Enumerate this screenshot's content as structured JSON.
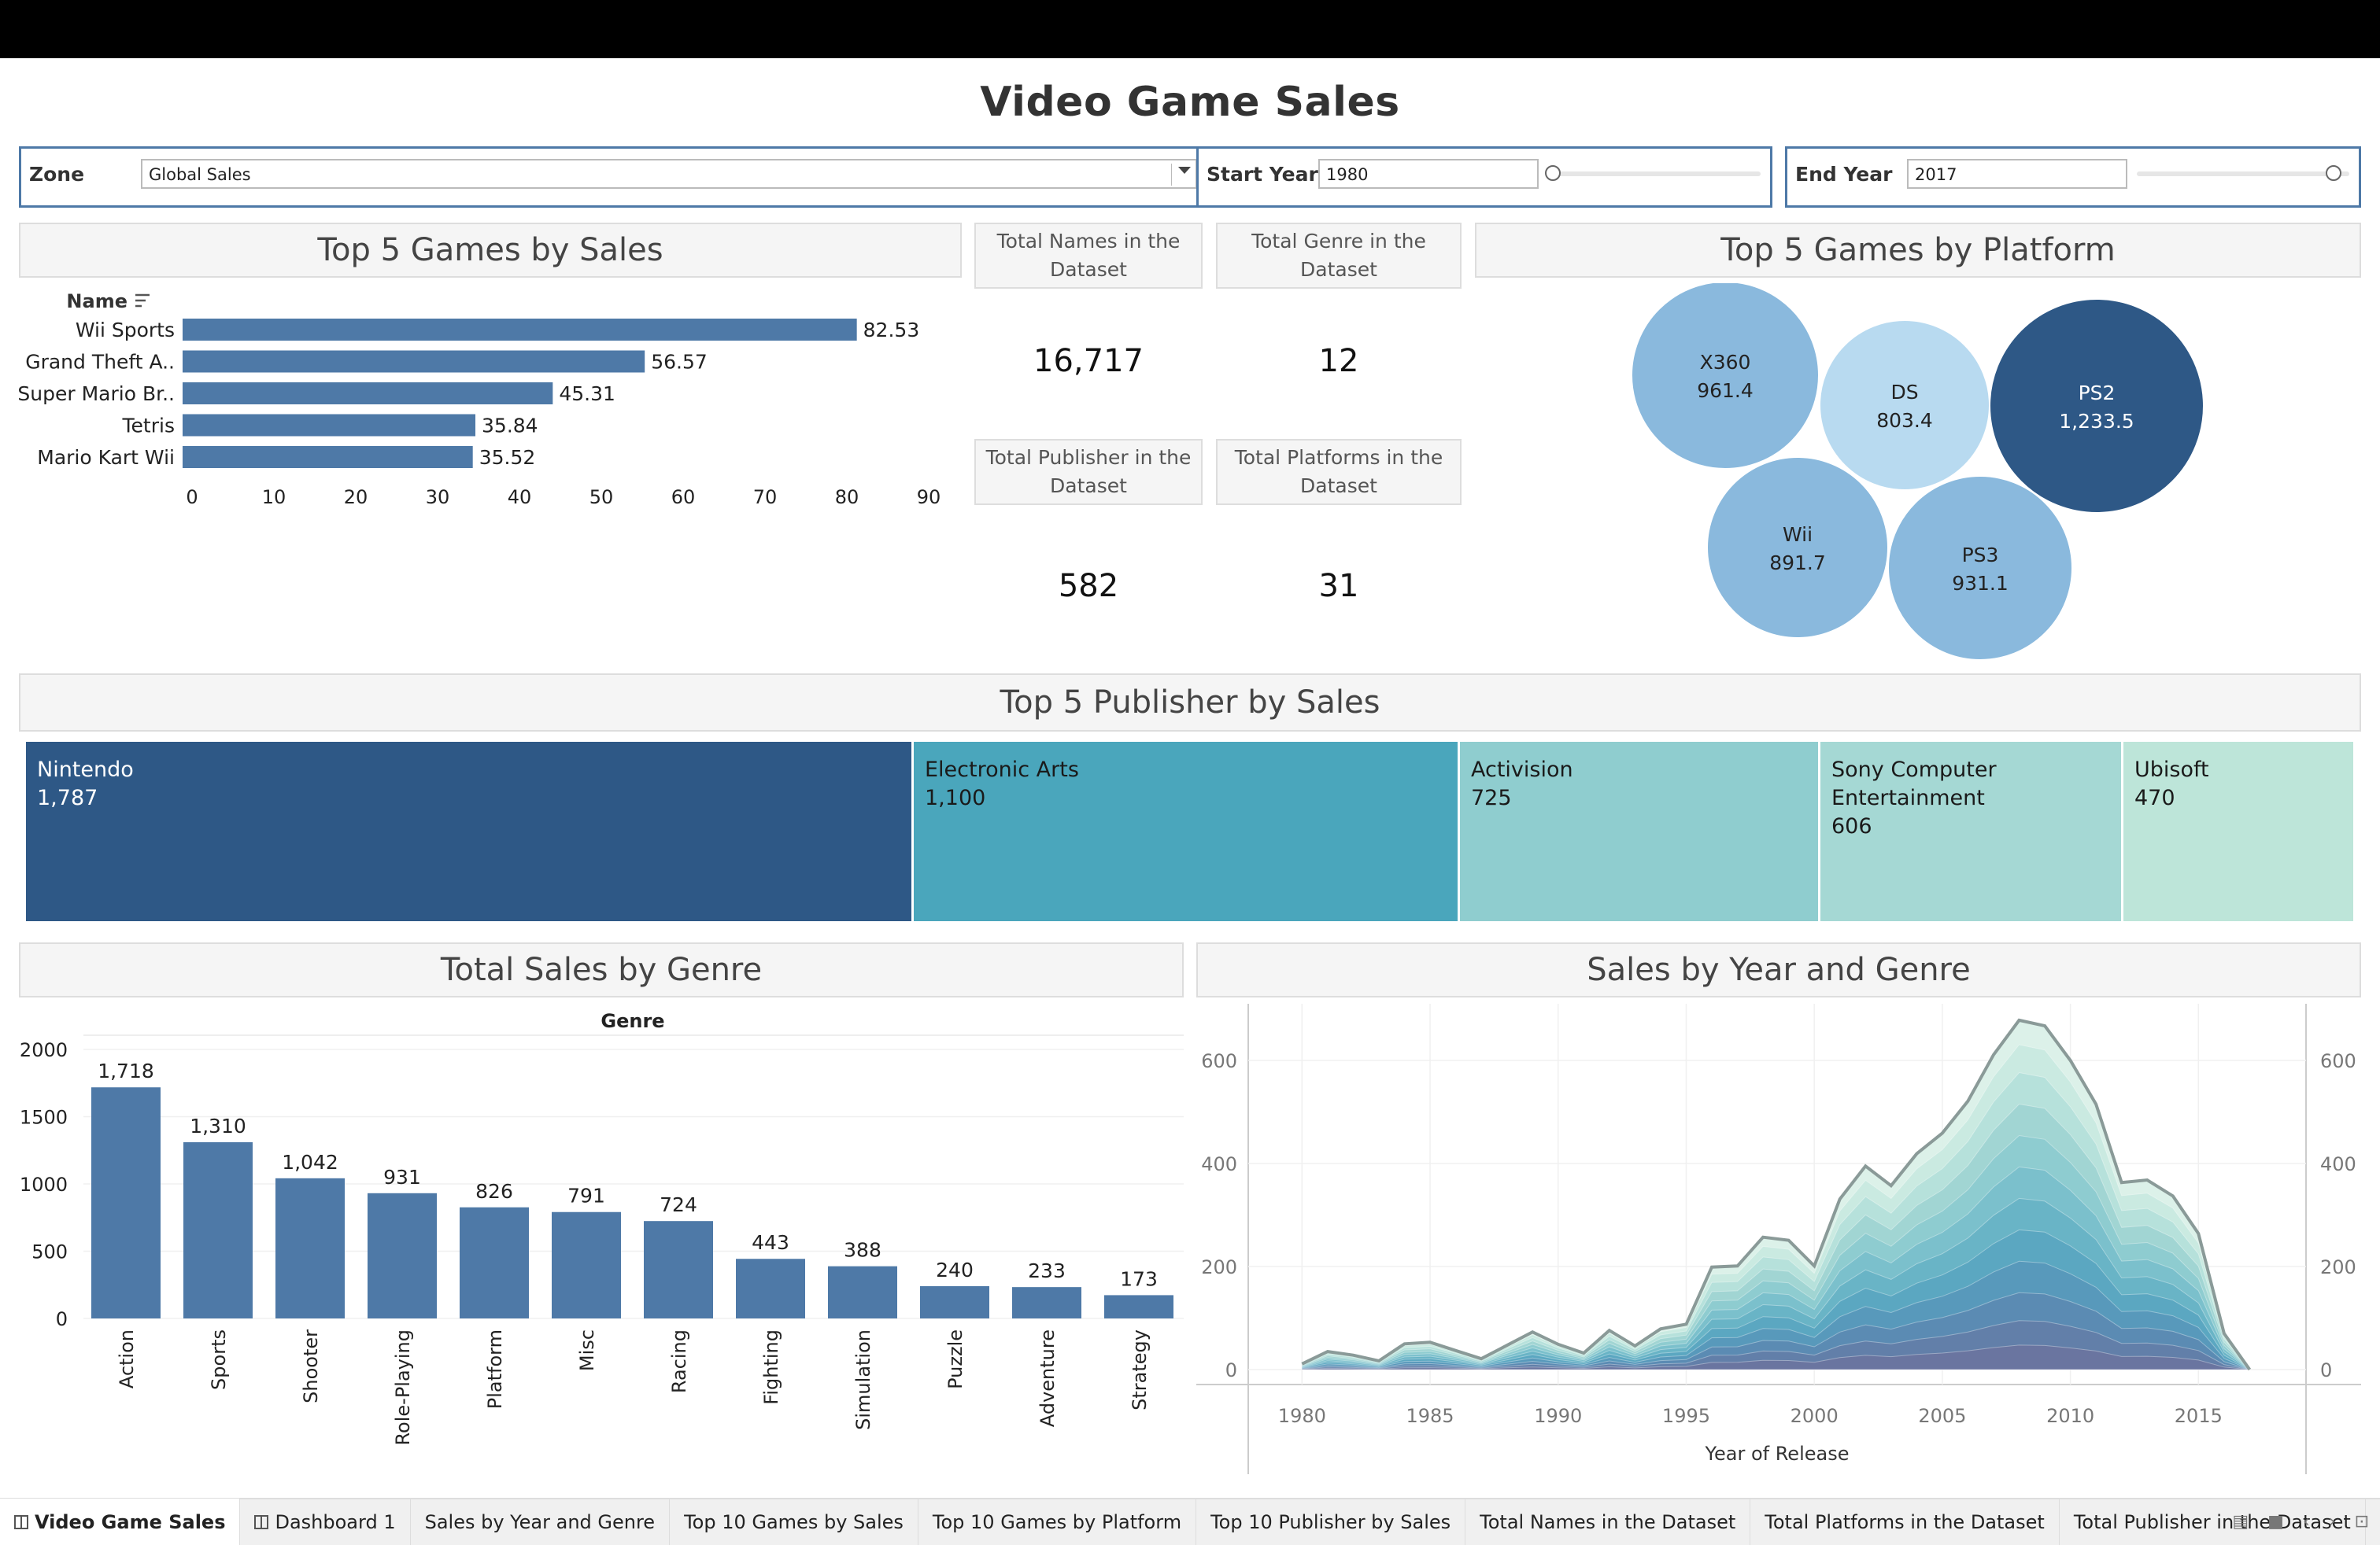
{
  "title": "Video Game Sales",
  "filters": {
    "zone_label": "Zone",
    "zone_value": "Global Sales",
    "start_label": "Start Year",
    "start_value": "1980",
    "end_label": "End Year",
    "end_value": "2017"
  },
  "sections": {
    "top_games": "Top 5 Games by Sales",
    "top_platform": "Top 5 Games by Platform",
    "top_publisher": "Top 5 Publisher by Sales",
    "genre_sales": "Total Sales by Genre",
    "year_genre": "Sales by Year and Genre"
  },
  "kpis": [
    {
      "label": "Total Names in the Dataset",
      "value": "16,717"
    },
    {
      "label": "Total Genre in the Dataset",
      "value": "12"
    },
    {
      "label": "Total Publisher in the Dataset",
      "value": "582"
    },
    {
      "label": "Total Platforms in the Dataset",
      "value": "31"
    }
  ],
  "colors": {
    "bar": "#4e79a7",
    "dark_blue": "#2e5886",
    "teal": "#4aa6bc",
    "light_teal": "#8fcdcf",
    "pale_teal": "#a5d8d4",
    "palest_teal": "#bde5d9",
    "bubble_light": "#b8daf0",
    "bubble_mid": "#8ab9dd"
  },
  "chart_data": [
    {
      "type": "bar",
      "orientation": "horizontal",
      "header": "Name",
      "categories": [
        "Wii Sports",
        "Grand Theft A..",
        "Super Mario Br..",
        "Tetris",
        "Mario Kart Wii"
      ],
      "values": [
        82.53,
        56.57,
        45.31,
        35.84,
        35.52
      ],
      "value_labels": [
        "82.53",
        "56.57",
        "45.31",
        "35.84",
        "35.52"
      ],
      "ticks": [
        "0",
        "10",
        "20",
        "30",
        "40",
        "50",
        "60",
        "70",
        "80",
        "90"
      ],
      "xlim": [
        0,
        95
      ]
    },
    {
      "type": "bubble",
      "items": [
        {
          "label": "X360",
          "value": 961.4,
          "value_label": "961.4"
        },
        {
          "label": "DS",
          "value": 803.4,
          "value_label": "803.4"
        },
        {
          "label": "PS2",
          "value": 1233.5,
          "value_label": "1,233.5"
        },
        {
          "label": "Wii",
          "value": 891.7,
          "value_label": "891.7"
        },
        {
          "label": "PS3",
          "value": 931.1,
          "value_label": "931.1"
        }
      ]
    },
    {
      "type": "treemap",
      "items": [
        {
          "label": "Nintendo",
          "value": 1787,
          "value_label": "1,787"
        },
        {
          "label": "Electronic Arts",
          "value": 1100,
          "value_label": "1,100"
        },
        {
          "label": "Activision",
          "value": 725,
          "value_label": "725"
        },
        {
          "label": "Sony Computer Entertainment",
          "value": 606,
          "value_label": "606"
        },
        {
          "label": "Ubisoft",
          "value": 470,
          "value_label": "470"
        }
      ]
    },
    {
      "type": "bar",
      "xlabel": "Genre",
      "categories": [
        "Action",
        "Sports",
        "Shooter",
        "Role-Playing",
        "Platform",
        "Misc",
        "Racing",
        "Fighting",
        "Simulation",
        "Puzzle",
        "Adventure",
        "Strategy"
      ],
      "values": [
        1718,
        1310,
        1042,
        931,
        826,
        791,
        724,
        443,
        388,
        240,
        233,
        173
      ],
      "value_labels": [
        "1,718",
        "1,310",
        "1,042",
        "931",
        "826",
        "791",
        "724",
        "443",
        "388",
        "240",
        "233",
        "173"
      ],
      "ticks": [
        "0",
        "500",
        "1000",
        "1500",
        "2000"
      ],
      "ylim": [
        0,
        2000
      ]
    },
    {
      "type": "area",
      "stacked": true,
      "xlabel": "Year of Release",
      "x_ticks": [
        "1980",
        "1985",
        "1990",
        "1995",
        "2000",
        "2005",
        "2010",
        "2015"
      ],
      "y_ticks": [
        "0",
        "200",
        "400",
        "600"
      ],
      "ylim": [
        -20,
        700
      ],
      "x": [
        1980,
        1981,
        1982,
        1983,
        1984,
        1985,
        1986,
        1987,
        1988,
        1989,
        1990,
        1991,
        1992,
        1993,
        1994,
        1995,
        1996,
        1997,
        1998,
        1999,
        2000,
        2001,
        2002,
        2003,
        2004,
        2005,
        2006,
        2007,
        2008,
        2009,
        2010,
        2011,
        2012,
        2013,
        2014,
        2015,
        2016,
        2017
      ],
      "total": [
        11,
        35,
        28,
        17,
        50,
        53,
        37,
        21,
        47,
        73,
        49,
        32,
        76,
        46,
        79,
        88,
        199,
        201,
        257,
        251,
        201,
        331,
        395,
        357,
        419,
        459,
        521,
        611,
        678,
        667,
        600,
        515,
        363,
        368,
        337,
        264,
        70,
        0
      ]
    }
  ],
  "tabs": [
    "Video Game Sales",
    "Dashboard 1",
    "Sales by Year and Genre",
    "Top 10 Games by Sales",
    "Top 10 Games by Platform",
    "Top 10 Publisher by Sales",
    "Total Names in the Dataset",
    "Total Platforms in the Dataset",
    "Total Publisher in the Dataset"
  ]
}
